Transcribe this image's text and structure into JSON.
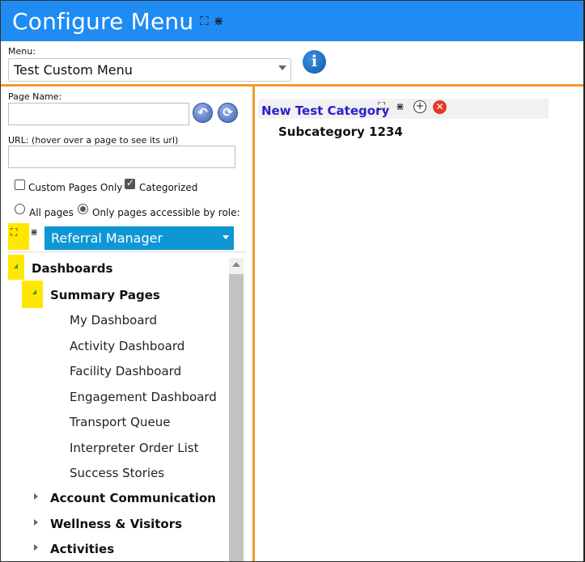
{
  "header": {
    "title": "Configure Menu",
    "expand_icon": "expand-icon",
    "collapse_icon": "collapse-icon"
  },
  "menu": {
    "label": "Menu:",
    "selected": "Test Custom Menu",
    "info_icon": "info-icon"
  },
  "left": {
    "page_name_label": "Page Name:",
    "page_name_value": "",
    "url_label": "URL: (hover over a page to see its url)",
    "url_value": "",
    "back_icon": "undo-arrow-icon",
    "refresh_icon": "refresh-icon",
    "custom_only_label": "Custom Pages Only",
    "custom_only_checked": false,
    "categorized_label": "Categorized",
    "categorized_checked": true,
    "all_pages_label": "All pages",
    "role_only_label": "Only pages accessible by role:",
    "role_selected": "Referral Manager",
    "tree": [
      {
        "label": "Dashboards",
        "level": 0,
        "expanded": true
      },
      {
        "label": "Summary Pages",
        "level": 1,
        "expanded": true
      },
      {
        "label": "My Dashboard",
        "level": 2
      },
      {
        "label": "Activity Dashboard",
        "level": 2
      },
      {
        "label": "Facility Dashboard",
        "level": 2
      },
      {
        "label": "Engagement Dashboard",
        "level": 2
      },
      {
        "label": "Transport Queue",
        "level": 2
      },
      {
        "label": "Interpreter Order List",
        "level": 2
      },
      {
        "label": "Success Stories",
        "level": 2
      },
      {
        "label": "Account Communication",
        "level": 1,
        "expanded": false
      },
      {
        "label": "Wellness & Visitors",
        "level": 1,
        "expanded": false
      },
      {
        "label": "Activities",
        "level": 1,
        "expanded": false
      }
    ]
  },
  "right": {
    "category_title": "New Test Category",
    "subcategory": "Subcategory 1234"
  },
  "colors": {
    "header_blue": "#1f8bf3",
    "accent_orange": "#f39a2a",
    "role_select_blue": "#0f96d5",
    "highlight_yellow": "#ffe800",
    "category_text": "#2a1fcc"
  }
}
